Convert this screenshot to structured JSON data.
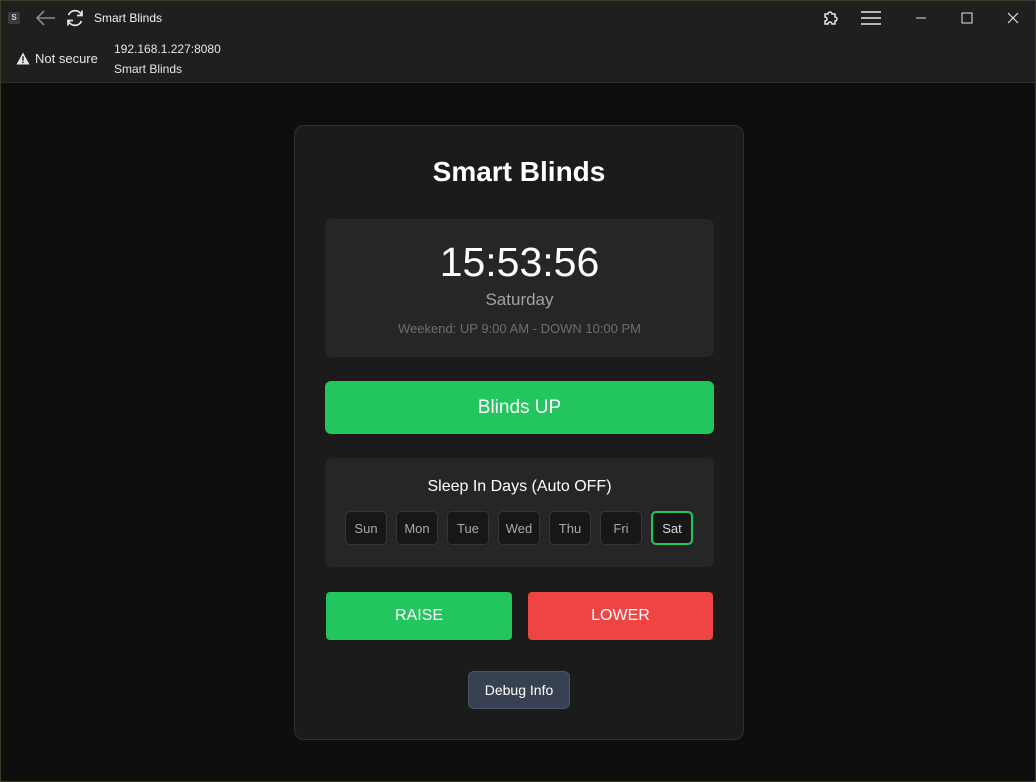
{
  "browser": {
    "tab_title": "Smart Blinds",
    "favicon_letter": "S",
    "security_label": "Not secure",
    "url": "192.168.1.227:8080",
    "page_name": "Smart Blinds",
    "icons": {
      "back": "back-arrow-icon",
      "reload": "reload-icon",
      "extensions": "puzzle-icon",
      "menu": "hamburger-menu-icon",
      "minimize": "minimize-icon",
      "maximize": "maximize-icon",
      "close": "close-icon",
      "security": "warning-triangle-icon"
    }
  },
  "app": {
    "title": "Smart Blinds",
    "clock": {
      "time": "15:53:56",
      "day": "Saturday",
      "schedule": "Weekend: UP 9:00 AM - DOWN 10:00 PM"
    },
    "status_button": "Blinds UP",
    "sleep": {
      "title": "Sleep In Days (Auto OFF)",
      "days": [
        {
          "label": "Sun",
          "active": false
        },
        {
          "label": "Mon",
          "active": false
        },
        {
          "label": "Tue",
          "active": false
        },
        {
          "label": "Wed",
          "active": false
        },
        {
          "label": "Thu",
          "active": false
        },
        {
          "label": "Fri",
          "active": false
        },
        {
          "label": "Sat",
          "active": true
        }
      ]
    },
    "raise_label": "RAISE",
    "lower_label": "LOWER",
    "debug_label": "Debug Info"
  },
  "colors": {
    "accent_green": "#22c55e",
    "accent_red": "#ef4444",
    "debug_bg": "#374151",
    "card_bg": "#1b1b1b",
    "page_bg": "#0e0e0e"
  }
}
